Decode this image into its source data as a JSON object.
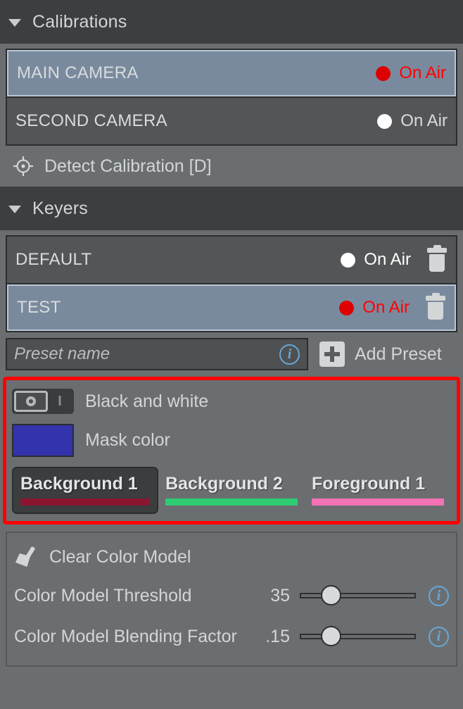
{
  "sections": {
    "calibrations": {
      "title": "Calibrations",
      "caret_icon": "caret-down-icon",
      "items": [
        {
          "name": "MAIN CAMERA",
          "on_air_label": "On Air",
          "on_air": true,
          "selected": true,
          "dot_color": "#dd0000",
          "text_color": "#ff0000"
        },
        {
          "name": "SECOND CAMERA",
          "on_air_label": "On Air",
          "on_air": false,
          "selected": false,
          "dot_color": "#ffffff",
          "text_color": "#d8dcdd"
        }
      ],
      "detect_button": {
        "label": "Detect Calibration [D]",
        "icon": "crosshair-target-icon"
      }
    },
    "keyers": {
      "title": "Keyers",
      "caret_icon": "caret-down-icon",
      "items": [
        {
          "name": "DEFAULT",
          "on_air_label": "On Air",
          "on_air": false,
          "selected": false,
          "dot_color": "#ffffff",
          "text_color": "#ffffff",
          "delete_icon": "trash-icon"
        },
        {
          "name": "TEST",
          "on_air_label": "On Air",
          "on_air": true,
          "selected": true,
          "dot_color": "#dd0000",
          "text_color": "#ff0000",
          "delete_icon": "trash-icon"
        }
      ],
      "preset": {
        "input_value": "",
        "input_placeholder": "Preset name",
        "info_icon": "info-icon",
        "add_label": "Add Preset",
        "add_icon": "plus-icon"
      }
    }
  },
  "highlighted": {
    "border_color": "#ff0000",
    "blackwhite": {
      "label": "Black and white",
      "toggle_off_glyph": "O",
      "toggle_on_glyph": "I",
      "state": "off"
    },
    "mask_color": {
      "label": "Mask color",
      "value": "#3333ad"
    },
    "samples": [
      {
        "label": "Background 1",
        "color": "#8b1530",
        "active": true
      },
      {
        "label": "Background 2",
        "color": "#2ecc71",
        "active": false
      },
      {
        "label": "Foreground 1",
        "color": "#f472b6",
        "active": false
      }
    ]
  },
  "color_model": {
    "clear": {
      "label": "Clear Color Model",
      "icon": "broom-icon"
    },
    "sliders": [
      {
        "label": "Color Model Threshold",
        "value": "35",
        "percent": 18,
        "info_icon": "info-icon"
      },
      {
        "label": "Color Model Blending Factor",
        "value": ".15",
        "percent": 18,
        "info_icon": "info-icon"
      }
    ]
  }
}
